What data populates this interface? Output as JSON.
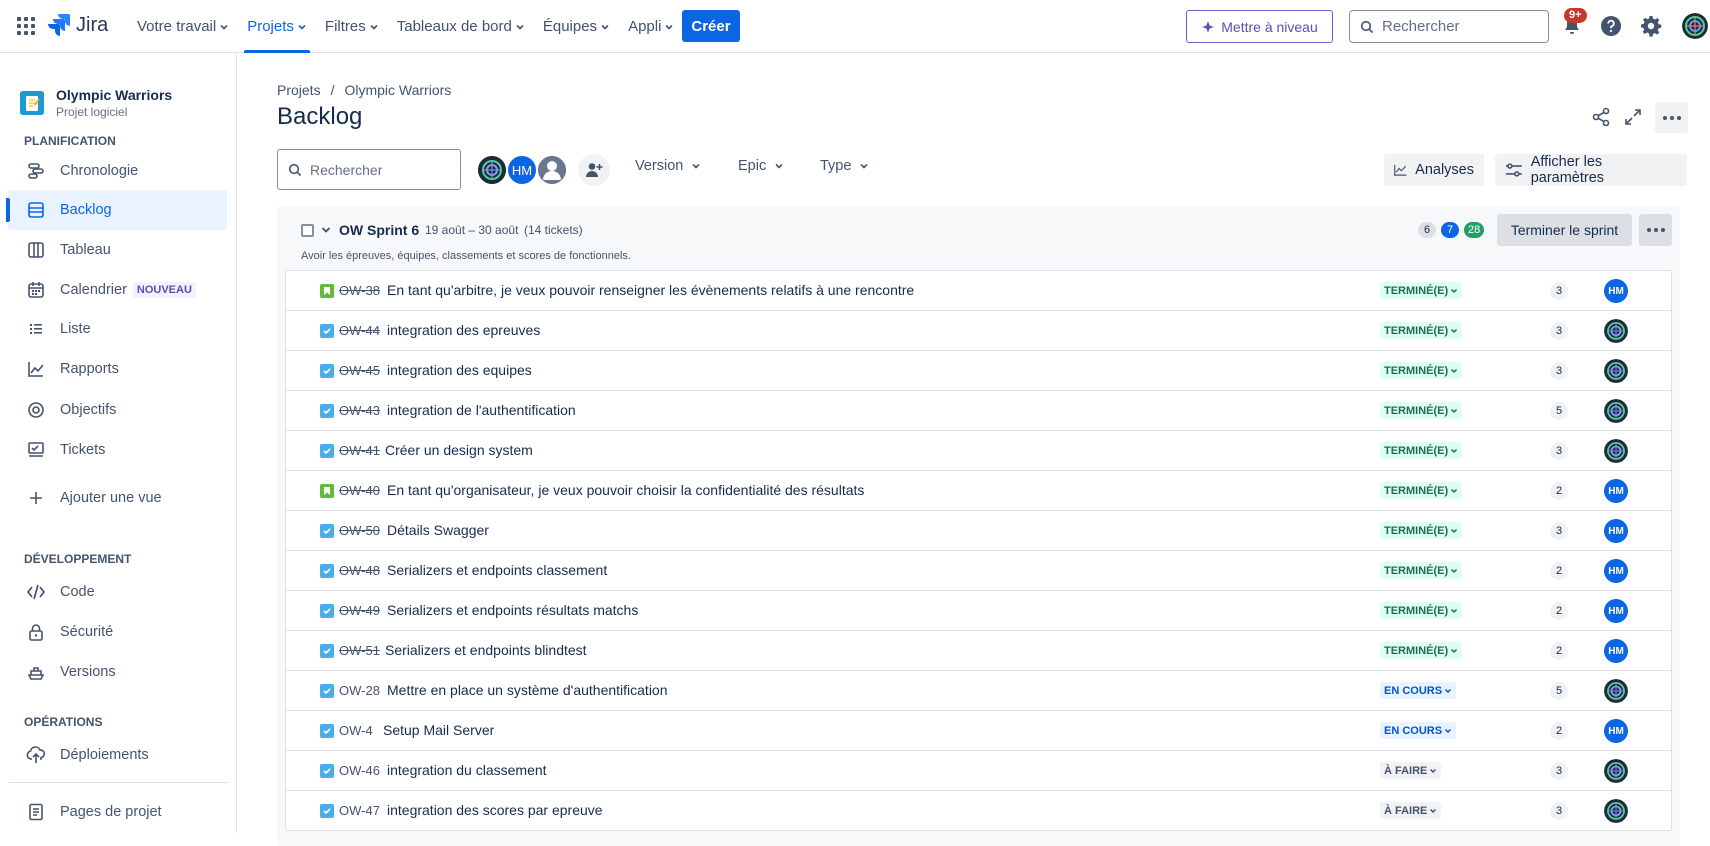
{
  "topnav": {
    "logo_text": "Jira",
    "menu": [
      {
        "label": "Votre travail"
      },
      {
        "label": "Projets"
      },
      {
        "label": "Filtres"
      },
      {
        "label": "Tableaux de bord"
      },
      {
        "label": "Équipes"
      },
      {
        "label": "Appli"
      }
    ],
    "create_label": "Créer",
    "upgrade_label": "Mettre à niveau",
    "search_placeholder": "Rechercher",
    "notif_badge": "9+",
    "accent_color": "#0c66e4"
  },
  "sidebar": {
    "project_name": "Olympic Warriors",
    "project_type": "Projet logiciel",
    "sections": {
      "planning": "PLANIFICATION",
      "dev": "DÉVELOPPEMENT",
      "ops": "OPÉRATIONS"
    },
    "items": {
      "timeline": "Chronologie",
      "backlog": "Backlog",
      "board": "Tableau",
      "calendar": "Calendrier",
      "calendar_badge": "NOUVEAU",
      "list": "Liste",
      "reports": "Rapports",
      "goals": "Objectifs",
      "issues": "Tickets",
      "add_view": "Ajouter une vue",
      "code": "Code",
      "security": "Sécurité",
      "releases": "Versions",
      "deployments": "Déploiements",
      "project_pages": "Pages de projet"
    }
  },
  "main": {
    "breadcrumb": {
      "root": "Projets",
      "sep": "/",
      "project": "Olympic Warriors"
    },
    "title": "Backlog",
    "search_placeholder": "Rechercher",
    "avatar_initials": "HM",
    "filters": {
      "version": "Version",
      "epic": "Epic",
      "type": "Type"
    },
    "insights_label": "Analyses",
    "view_settings_label": "Afficher les paramètres"
  },
  "sprint": {
    "name": "OW Sprint 6",
    "dates": "19 août – 30 août",
    "count": "(14 tickets)",
    "goal": "Avoir les épreuves, équipes, classements et scores de fonctionnels.",
    "points_todo": "6",
    "points_progress": "7",
    "points_done": "28",
    "complete_label": "Terminer le sprint",
    "issues": [
      {
        "type": "story",
        "key": "OW-38",
        "summary": "En tant qu'arbitre, je veux pouvoir renseigner les évènements relatifs à une rencontre",
        "status": "TERMINÉ(E)",
        "state": "done",
        "points": "3",
        "assignee": "HM"
      },
      {
        "type": "task",
        "key": "OW-44",
        "summary": "integration des epreuves",
        "status": "TERMINÉ(E)",
        "state": "done",
        "points": "3",
        "assignee": "avatar"
      },
      {
        "type": "task",
        "key": "OW-45",
        "summary": "integration des equipes",
        "status": "TERMINÉ(E)",
        "state": "done",
        "points": "3",
        "assignee": "avatar"
      },
      {
        "type": "task",
        "key": "OW-43",
        "summary": "integration de l'authentification",
        "status": "TERMINÉ(E)",
        "state": "done",
        "points": "5",
        "assignee": "avatar"
      },
      {
        "type": "task",
        "key": "OW-41",
        "summary": "Créer un design system",
        "status": "TERMINÉ(E)",
        "state": "done",
        "points": "3",
        "assignee": "avatar"
      },
      {
        "type": "story",
        "key": "OW-40",
        "summary": "En tant qu'organisateur, je veux pouvoir choisir la confidentialité des résultats",
        "status": "TERMINÉ(E)",
        "state": "done",
        "points": "2",
        "assignee": "HM"
      },
      {
        "type": "task",
        "key": "OW-50",
        "summary": "Détails Swagger",
        "status": "TERMINÉ(E)",
        "state": "done",
        "points": "3",
        "assignee": "HM"
      },
      {
        "type": "task",
        "key": "OW-48",
        "summary": "Serializers et endpoints classement",
        "status": "TERMINÉ(E)",
        "state": "done",
        "points": "2",
        "assignee": "HM"
      },
      {
        "type": "task",
        "key": "OW-49",
        "summary": "Serializers et endpoints résultats matchs",
        "status": "TERMINÉ(E)",
        "state": "done",
        "points": "2",
        "assignee": "HM"
      },
      {
        "type": "task",
        "key": "OW-51",
        "summary": "Serializers et endpoints blindtest",
        "status": "TERMINÉ(E)",
        "state": "done",
        "points": "2",
        "assignee": "HM"
      },
      {
        "type": "task",
        "key": "OW-28",
        "summary": "Mettre en place un système d'authentification",
        "status": "EN COURS",
        "state": "progress",
        "points": "5",
        "assignee": "avatar"
      },
      {
        "type": "task",
        "key": "OW-4",
        "summary": "Setup Mail Server",
        "status": "EN COURS",
        "state": "progress",
        "points": "2",
        "assignee": "HM"
      },
      {
        "type": "task",
        "key": "OW-46",
        "summary": "integration du classement",
        "status": "À FAIRE",
        "state": "todo",
        "points": "3",
        "assignee": "avatar"
      },
      {
        "type": "task",
        "key": "OW-47",
        "summary": "integration des scores par epreuve",
        "status": "À FAIRE",
        "state": "todo",
        "points": "3",
        "assignee": "avatar"
      }
    ]
  }
}
